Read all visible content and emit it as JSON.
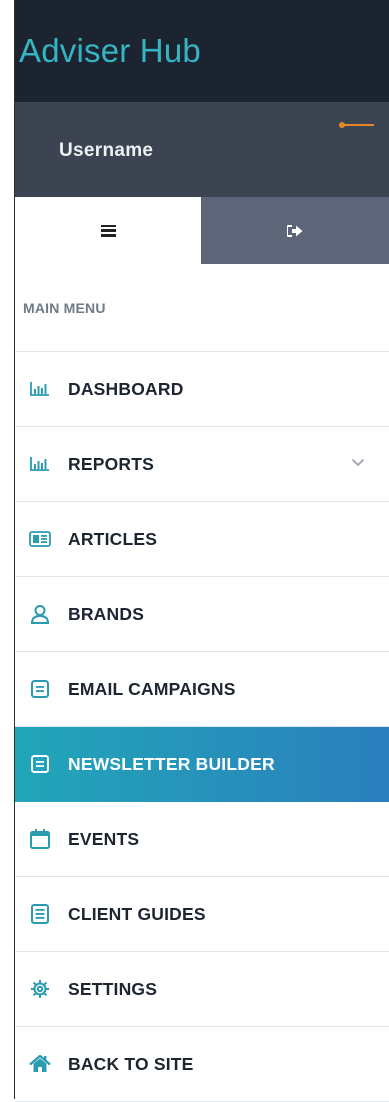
{
  "brand": {
    "title": "Adviser Hub"
  },
  "user": {
    "name": "Username"
  },
  "tabs": [
    {
      "icon": "hamburger-menu-icon"
    },
    {
      "icon": "sign-out-icon"
    }
  ],
  "menu": {
    "header": "MAIN MENU",
    "items": [
      {
        "label": "DASHBOARD",
        "icon": "bar-chart-icon"
      },
      {
        "label": "REPORTS",
        "icon": "bar-chart-icon",
        "has_submenu": true
      },
      {
        "label": "ARTICLES",
        "icon": "newspaper-icon"
      },
      {
        "label": "BRANDS",
        "icon": "user-icon"
      },
      {
        "label": "EMAIL CAMPAIGNS",
        "icon": "envelope-icon"
      },
      {
        "label": "NEWSLETTER BUILDER",
        "icon": "envelope-icon",
        "active": true
      },
      {
        "label": "EVENTS",
        "icon": "calendar-icon"
      },
      {
        "label": "CLIENT GUIDES",
        "icon": "document-icon"
      },
      {
        "label": "SETTINGS",
        "icon": "gear-icon"
      },
      {
        "label": "BACK TO SITE",
        "icon": "home-icon"
      }
    ]
  },
  "colors": {
    "brand_bg": "#1c2331",
    "brand_text": "#35b4c2",
    "user_bg": "#3c4351",
    "tab_inactive_bg": "#5d6678",
    "accent_start": "#22a6b9",
    "accent_end": "#2a7fbd",
    "icon": "#2b9bb0",
    "status": "#e8872a"
  }
}
